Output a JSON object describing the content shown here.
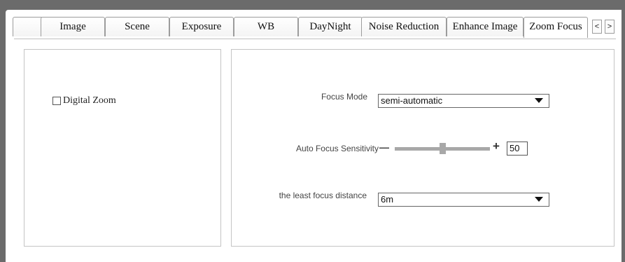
{
  "tabs": [
    {
      "label": ""
    },
    {
      "label": "Image"
    },
    {
      "label": "Scene"
    },
    {
      "label": "Exposure"
    },
    {
      "label": "WB"
    },
    {
      "label": "DayNight"
    },
    {
      "label": "Noise Reduction"
    },
    {
      "label": "Enhance Image"
    },
    {
      "label": "Zoom Focus"
    }
  ],
  "active_tab": "Zoom Focus",
  "nav": {
    "prev": "<",
    "next": ">"
  },
  "left_panel": {
    "digital_zoom_label": "Digital Zoom",
    "digital_zoom_checked": false
  },
  "right_panel": {
    "focus_mode_label": "Focus Mode",
    "focus_mode_value": "semi-automatic",
    "sensitivity_label": "Auto Focus Sensitivity",
    "sensitivity_minus": "—",
    "sensitivity_plus": "+",
    "sensitivity_value": "50",
    "sensitivity_level_percent": 50,
    "least_distance_label": "the least focus distance",
    "least_distance_value": "6m"
  },
  "colors": {
    "frame": "#6b6b6b",
    "border": "#9c9c9c",
    "slider": "#a8a8a8"
  }
}
